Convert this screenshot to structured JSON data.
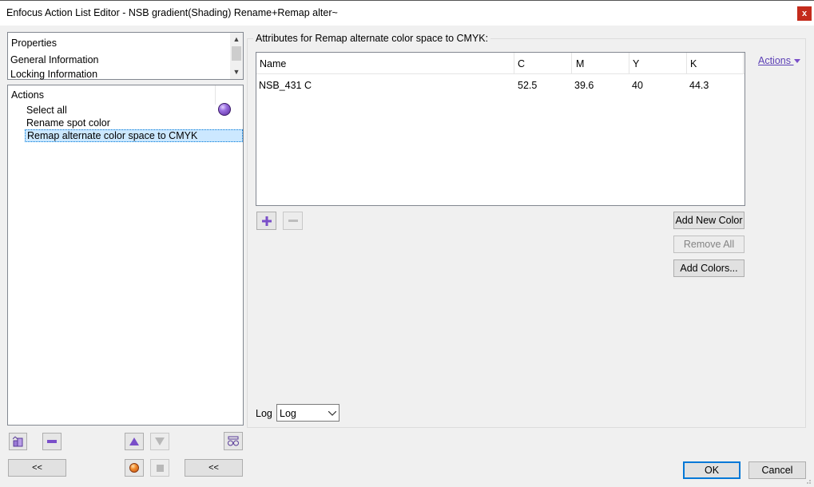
{
  "window": {
    "title": "Enfocus Action List Editor - NSB gradient(Shading) Rename+Remap alter~",
    "close_glyph": "x"
  },
  "properties_panel": {
    "items": [
      "Properties",
      "General Information",
      "Locking Information"
    ]
  },
  "actions_panel": {
    "header": "Actions",
    "items": [
      "Select all",
      "Rename spot color",
      "Remap alternate color space to CMYK"
    ],
    "selected_index": 2
  },
  "attributes_group": {
    "title": "Attributes for Remap alternate color space to CMYK:",
    "columns": [
      "Name",
      "C",
      "M",
      "Y",
      "K"
    ],
    "rows": [
      {
        "name": "NSB_431 C",
        "c": "52.5",
        "m": "39.6",
        "y": "40",
        "k": "44.3"
      }
    ]
  },
  "actions_link": "Actions",
  "buttons": {
    "add_new_color": "Add New Color",
    "remove_all": "Remove All",
    "add_colors": "Add Colors...",
    "ok": "OK",
    "cancel": "Cancel",
    "collapse_left": "<<",
    "collapse_right": "<<"
  },
  "log": {
    "label": "Log",
    "selected": "Log"
  },
  "colors": {
    "accent": "#0078d7",
    "purple": "#7a4fc9",
    "selection": "#cce8ff"
  }
}
